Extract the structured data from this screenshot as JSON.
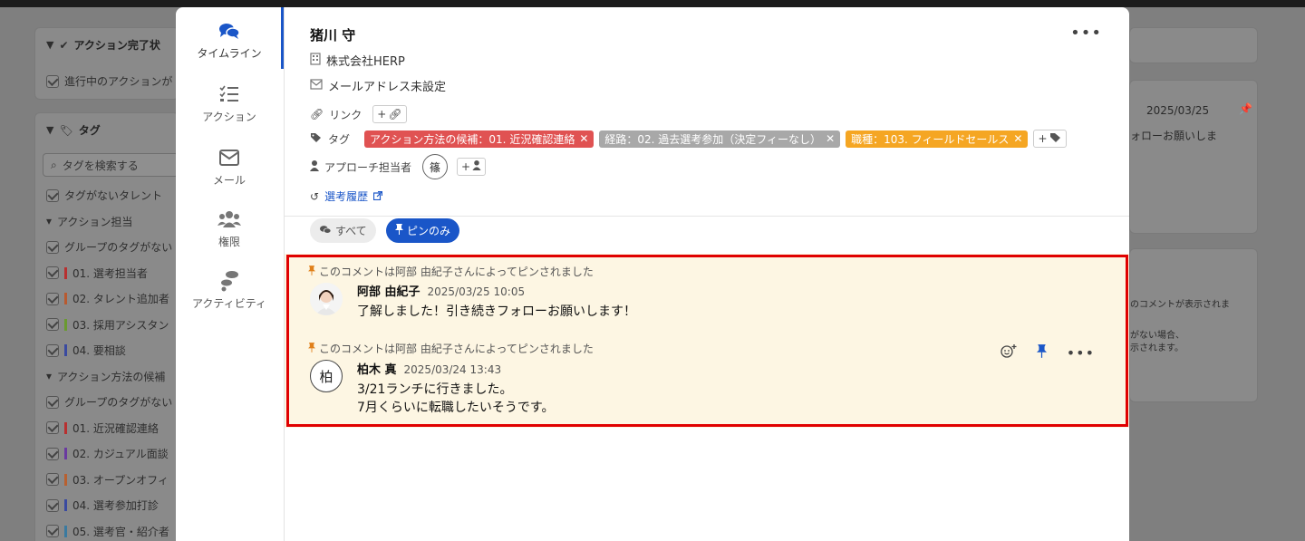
{
  "background": {
    "left_panel": {
      "section1_title": "アクション完了状",
      "section1_item": "進行中のアクションが",
      "tags_title": "タグ",
      "tag_search_placeholder": "タグを検索する",
      "items": [
        {
          "label": "タグがないタレント",
          "color": ""
        },
        {
          "label": "アクション担当",
          "color": "",
          "group": true
        },
        {
          "label": "グループのタグがない",
          "color": ""
        },
        {
          "label": "01. 選考担当者",
          "color": "#b83030"
        },
        {
          "label": "02. タレント追加者",
          "color": "#b85a30"
        },
        {
          "label": "03. 採用アシスタン",
          "color": "#6a9a30"
        },
        {
          "label": "04. 要相談",
          "color": "#3a4aa0"
        },
        {
          "label": "アクション方法の候補",
          "color": "",
          "group": true
        },
        {
          "label": "グループのタグがない",
          "color": ""
        },
        {
          "label": "01. 近況確認連絡",
          "color": "#b83030"
        },
        {
          "label": "02. カジュアル面談",
          "color": "#6a3aa0"
        },
        {
          "label": "03. オープンオフィ",
          "color": "#b86030"
        },
        {
          "label": "04. 選考参加打診",
          "color": "#3a4aa0"
        },
        {
          "label": "05. 選考官・紹介者",
          "color": "#3a7aa0"
        }
      ]
    },
    "right_panel": {
      "date": "2025/03/25",
      "snippet": "ォローお願いしま",
      "empty_line1": "のコメントが表示されま",
      "empty_line2": "がない場合、",
      "empty_line3": "示されます。"
    }
  },
  "nav": [
    {
      "label": "タイムライン",
      "icon": "comments-icon"
    },
    {
      "label": "アクション",
      "icon": "checklist-icon"
    },
    {
      "label": "メール",
      "icon": "envelope-icon"
    },
    {
      "label": "権限",
      "icon": "users-icon"
    },
    {
      "label": "アクティビティ",
      "icon": "footsteps-icon"
    }
  ],
  "candidate": {
    "name": "猪川 守",
    "company": "株式会社HERP",
    "email": "メールアドレス未設定"
  },
  "meta": {
    "link_label": "リンク",
    "tag_label": "タグ",
    "tags": [
      {
        "text": "アクション方法の候補：01. 近況確認連絡",
        "color": "#e05252"
      },
      {
        "text": "経路：02. 過去選考参加（決定フィーなし）",
        "color": "#a8a8a8"
      },
      {
        "text": "職種：103. フィールドセールス",
        "color": "#f5a623"
      }
    ],
    "assignee_label": "アプローチ担当者",
    "assignee_initial": "篠",
    "history_label": "選考履歴"
  },
  "filters": {
    "all": "すべて",
    "pinned": "ピンのみ"
  },
  "comments": [
    {
      "pin_note": "このコメントは阿部 由紀子さんによってピンされました",
      "author": "阿部 由紀子",
      "time": "2025/03/25 10:05",
      "line1": "了解しました！引き続きフォローお願いします！",
      "line2": ""
    },
    {
      "pin_note": "このコメントは阿部 由紀子さんによってピンされました",
      "author": "柏木 真",
      "avatar_initial": "柏",
      "time": "2025/03/24 13:43",
      "line1": "3/21ランチに行きました。",
      "line2": "7月くらいに転職したいそうです。"
    }
  ],
  "colors": {
    "accent": "#1a56c8",
    "pinned_bg": "#fdf6e3",
    "highlight": "#e00000",
    "pin_orange": "#e0801a"
  }
}
